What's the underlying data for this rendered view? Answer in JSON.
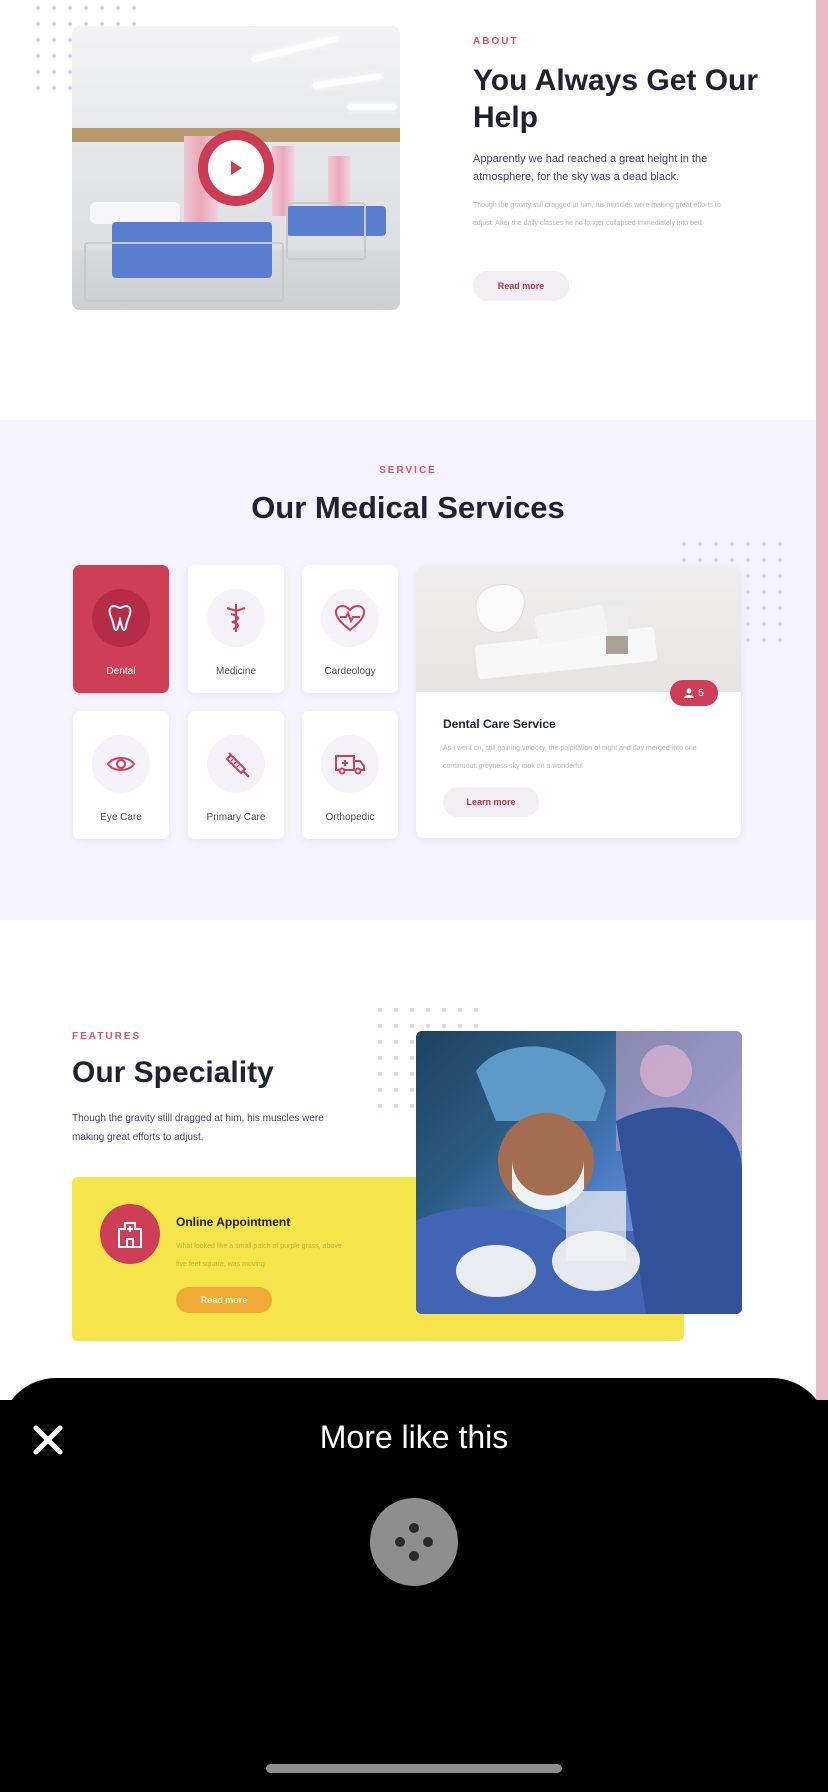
{
  "about": {
    "eyebrow": "ABOUT",
    "title": "You Always Get Our Help",
    "text": "Apparently we had reached a great height in the atmosphere, for the sky was a dead black.",
    "subtext": "Though the gravity still dragged at him, his muscles were making great efforts to adjust. After the daily classes he no longer collapsed immediately into bed.",
    "button": "Read more",
    "play_icon": "play-icon"
  },
  "services": {
    "eyebrow": "SERVICE",
    "title": "Our Medical Services",
    "items": [
      {
        "label": "Dental",
        "icon": "tooth-icon"
      },
      {
        "label": "Medicine",
        "icon": "caduceus-icon"
      },
      {
        "label": "Cardeology",
        "icon": "heart-pulse-icon"
      },
      {
        "label": "Eye Care",
        "icon": "eye-icon"
      },
      {
        "label": "Primary Care",
        "icon": "syringe-icon"
      },
      {
        "label": "Orthopedic",
        "icon": "ambulance-icon"
      }
    ],
    "detail": {
      "count": "5",
      "title": "Dental Care Service",
      "text": "As I went on, still gaining velocity, the palpitation of night and day merged into one continuous greyness sky took on a wonderful",
      "button": "Learn more"
    }
  },
  "features": {
    "eyebrow": "FEATURES",
    "title": "Our Speciality",
    "text": "Though the gravity still dragged at him, his muscles were making great efforts to adjust.",
    "appointment": {
      "title": "Online Appointment",
      "text": "What looked like a small patch of purple grass, above five feet square, was moving",
      "button": "Read more"
    }
  },
  "sheet": {
    "title": "More like this"
  },
  "colors": {
    "accent": "#cf3e57",
    "yellow": "#f6e44b",
    "services_bg": "#f5f4fc"
  }
}
